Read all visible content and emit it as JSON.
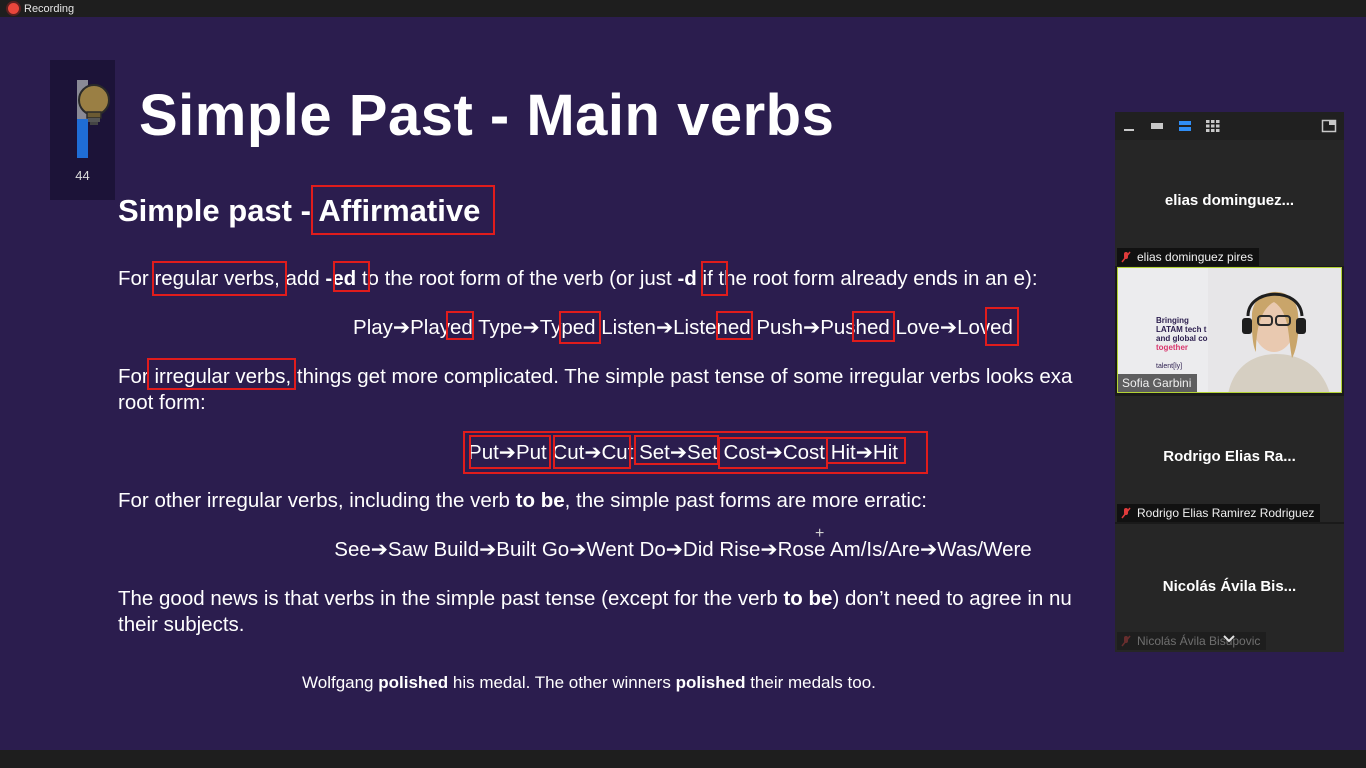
{
  "app": {
    "recording_label": "Recording",
    "colors": {
      "background": "#2b1d4e",
      "highlight_box": "#e01c1c",
      "active_speaker": "#b3d334",
      "recording": "#e8463c"
    }
  },
  "slide": {
    "badge_number": "44",
    "meter_level_percent": 50,
    "title": "Simple Past - Main verbs",
    "subtitle_prefix": "Simple past - ",
    "subtitle_highlight": "Affirmative",
    "para1": {
      "t1": "For ",
      "t2": "regular verbs",
      "t3": ", add ",
      "t4": "-ed",
      "t5": " to the root form of the verb (or just ",
      "t6": "-d",
      "t7": " if the root form already ends in an e):"
    },
    "regular_examples": "Play➔Played Type➔Typed Listen➔Listened Push➔Pushed Love➔Loved",
    "para2": {
      "t1": "For ",
      "t2": "irregular verbs",
      "t3": ", things get more complicated. The simple past tense of some irregular verbs looks exa",
      "t4": "root form:"
    },
    "irregular_same": "Put➔Put Cut➔Cut Set➔Set Cost➔Cost Hit➔Hit",
    "para3": {
      "t1": "For other irregular verbs, including the verb ",
      "t2": "to be",
      "t3": ", the simple past forms are more erratic:"
    },
    "irregular_erratic": "See➔Saw Build➔Built Go➔Went Do➔Did Rise➔Rose Am/Is/Are➔Was/Were",
    "para4": {
      "t1": "The good news is that verbs in the simple past tense (except for the verb ",
      "t2": "to be",
      "t3": ") don’t need to agree in nu",
      "t4": "their subjects."
    },
    "example": {
      "t1": "Wolfgang ",
      "t2": "polished",
      "t3": " his medal. The other winners ",
      "t4": "polished",
      "t5": " their medals too."
    }
  },
  "gallery": {
    "view_icons": [
      "minimize-icon",
      "small-view-icon",
      "speaker-view-icon",
      "gallery-view-icon",
      "exit-fullscreen-icon"
    ],
    "participants": [
      {
        "display": "elias  dominguez...",
        "tag": "elias dominguez pires",
        "muted": true
      },
      {
        "display": "",
        "tag": "Sofia Garbini",
        "muted": false,
        "video": true,
        "poster_lines": [
          "Bringing",
          "LATAM tech t",
          "and global co",
          "together",
          "talent[ly]"
        ]
      },
      {
        "display": "Rodrigo  Elias  Ra...",
        "tag": "Rodrigo Elias Ramirez Rodriguez",
        "muted": true
      },
      {
        "display": "Nicolás  Ávila  Bis...",
        "tag": "Nicolás Ávila Bisupovic",
        "muted": true
      }
    ]
  }
}
